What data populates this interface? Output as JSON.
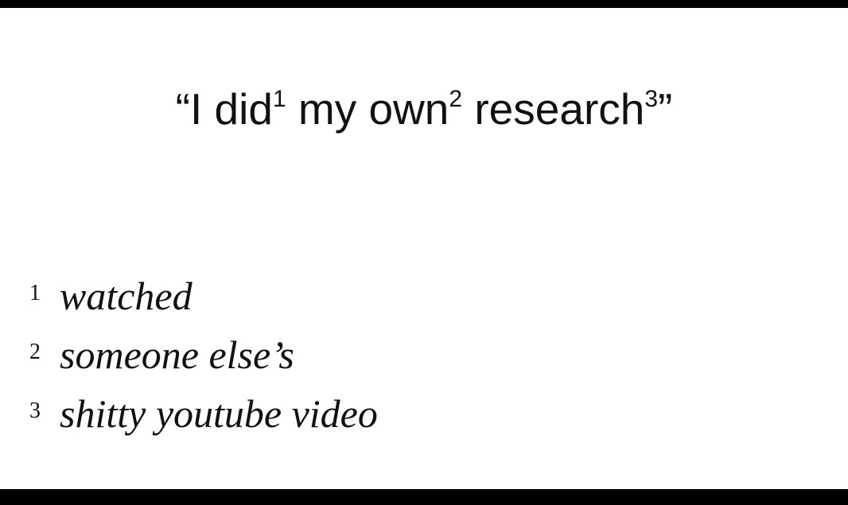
{
  "colors": {
    "background": "#ffffff",
    "text": "#111111",
    "border": "#000000"
  },
  "headline": {
    "open_quote": "“",
    "word1": "I did",
    "sup1": "1",
    "word2": " my own",
    "sup2": "2",
    "word3": " research",
    "sup3": "3",
    "close_quote": "”"
  },
  "footnotes": [
    {
      "number": "1",
      "text": "watched"
    },
    {
      "number": "2",
      "text": "someone else’s"
    },
    {
      "number": "3",
      "text": "shitty youtube video"
    }
  ]
}
